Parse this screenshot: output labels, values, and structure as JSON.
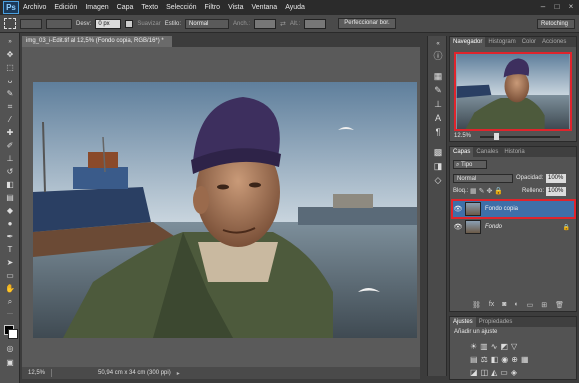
{
  "app": {
    "logo": "Ps",
    "accent": "#3a8fd6"
  },
  "menubar": {
    "items": [
      "Archivo",
      "Edición",
      "Imagen",
      "Capa",
      "Texto",
      "Selección",
      "Filtro",
      "Vista",
      "Ventana",
      "Ayuda"
    ]
  },
  "options": {
    "desv_label": "Desv:",
    "desv_value": "0 px",
    "suavizar": "Suavizar",
    "estilo_label": "Estilo:",
    "estilo_value": "Normal",
    "anch_label": "Anch.:",
    "alt_label": "Alt.:",
    "refine_button": "Perfeccionar bor.",
    "workspace": "Retoching"
  },
  "document": {
    "tab_title": "img_03_i-Edit.tif al 12,5% (Fondo copia, RGB/16*) *",
    "zoom": "12,5%",
    "doc_size": "50,94 cm x 34 cm (300 ppi)"
  },
  "navigator": {
    "tabs": [
      "Navegador",
      "Histogram",
      "Color",
      "Acciones"
    ],
    "zoom": "12.5%"
  },
  "layers_panel": {
    "tabs": [
      "Capas",
      "Canales",
      "Historia"
    ],
    "kind_select": "Tipo",
    "blend_mode": "Normal",
    "opacity_label": "Opacidad:",
    "opacity_value": "100%",
    "lock_label": "Bloq.:",
    "fill_label": "Relleno:",
    "fill_value": "100%",
    "layers": [
      {
        "name": "Fondo copia",
        "selected": true
      },
      {
        "name": "Fondo",
        "selected": false
      }
    ],
    "highlight_color": "#e0242c"
  },
  "adjustments": {
    "tabs": [
      "Ajustes",
      "Propiedades"
    ],
    "title": "Añadir un ajuste"
  }
}
